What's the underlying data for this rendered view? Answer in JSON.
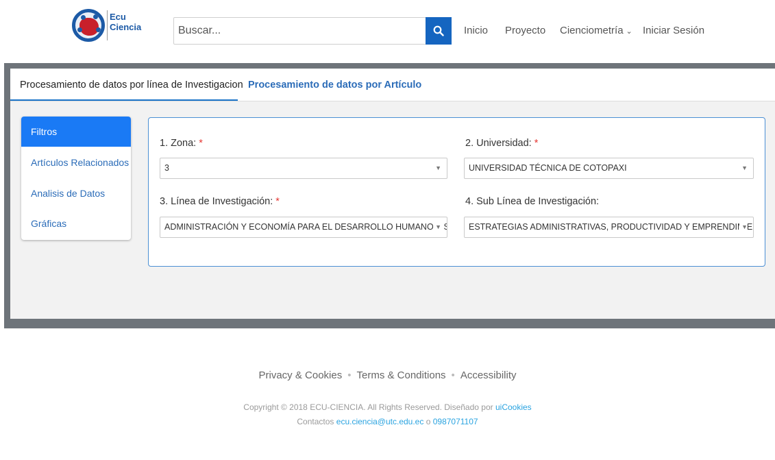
{
  "header": {
    "logo_text_line1": "Ecu",
    "logo_text_line2": "Ciencia",
    "search_placeholder": "Buscar...",
    "nav": {
      "inicio": "Inicio",
      "proyecto": "Proyecto",
      "cienciometria": "Cienciometría",
      "login": "Iniciar Sesión"
    }
  },
  "tabs": [
    {
      "label": "Procesamiento de datos por línea de Investigacion",
      "active": true
    },
    {
      "label": "Procesamiento de datos por Artículo",
      "active": false
    }
  ],
  "sidebar": {
    "items": [
      {
        "label": "Filtros",
        "active": true
      },
      {
        "label": "Artículos Relacionados"
      },
      {
        "label": "Analisis de Datos"
      },
      {
        "label": "Gráficas"
      }
    ]
  },
  "filters": {
    "zona": {
      "label": "1. Zona:",
      "required": "*",
      "value": "3"
    },
    "universidad": {
      "label": "2. Universidad:",
      "required": "*",
      "value": "UNIVERSIDAD TÉCNICA DE COTOPAXI"
    },
    "linea": {
      "label": "3. Línea de Investigación:",
      "required": "*",
      "value": "ADMINISTRACIÓN Y ECONOMÍA PARA EL DESARROLLO HUMANO Y SOCIAL"
    },
    "sublinea": {
      "label": "4. Sub Línea de Investigación:",
      "value": "ESTRATEGIAS ADMINISTRATIVAS, PRODUCTIVIDAD Y EMPRENDIMIENTO"
    }
  },
  "footer": {
    "privacy": "Privacy & Cookies",
    "terms": "Terms & Conditions",
    "accessibility": "Accessibility",
    "bullet": "•",
    "copyright": "Copyright © 2018 ECU-CIENCIA. All Rights Reserved. Diseñado por",
    "designer": "uiCookies",
    "contacts_label": "Contactos",
    "email": "ecu.ciencia@utc.edu.ec",
    "or": "o",
    "phone": "0987071107"
  },
  "colors": {
    "primary": "#1a7af5",
    "search_button": "#1565c0",
    "link": "#2b6cb8",
    "required": "#e53935",
    "frame": "#6e747a"
  }
}
